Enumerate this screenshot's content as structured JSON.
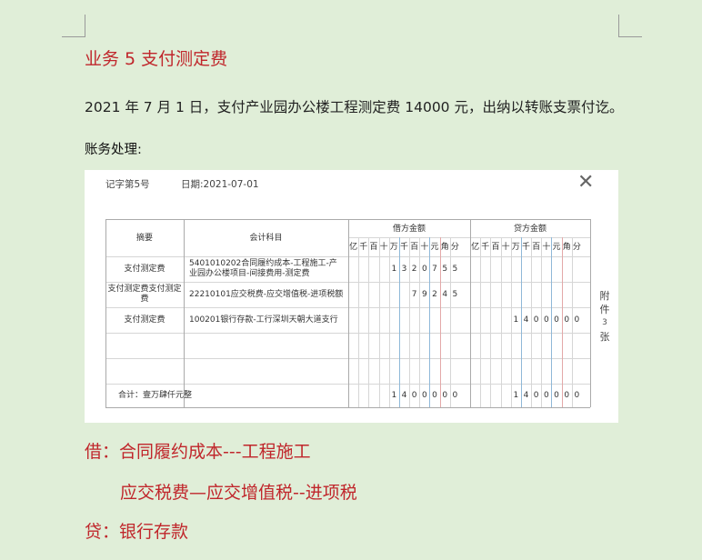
{
  "heading": "业务 5 支付测定费",
  "description": "2021 年 7 月 1 日，支付产业园办公楼工程测定费 14000 元，出纳以转账支票付讫。",
  "subheading": "账务处理:",
  "voucher": {
    "voucher_no": "记字第5号",
    "date": "日期:2021-07-01",
    "close_label": "✕",
    "headers": {
      "summary": "摘要",
      "account": "会计科目",
      "debit": "借方金额",
      "credit": "贷方金额",
      "units": [
        "亿",
        "千",
        "百",
        "十",
        "万",
        "千",
        "百",
        "十",
        "元",
        "角",
        "分"
      ]
    },
    "rows": [
      {
        "summary": "支付测定费",
        "account": "5401010202合同履约成本-工程施工-产业园办公楼项目-间接费用-测定费",
        "debit": [
          "",
          "",
          "",
          "",
          "1",
          "3",
          "2",
          "0",
          "7",
          "5",
          "5"
        ],
        "credit": [
          "",
          "",
          "",
          "",
          "",
          "",
          "",
          "",
          "",
          "",
          ""
        ]
      },
      {
        "summary": "支付测定费支付测定费",
        "account": "22210101应交税费-应交增值税-进项税额",
        "debit": [
          "",
          "",
          "",
          "",
          "",
          "",
          "7",
          "9",
          "2",
          "4",
          "5"
        ],
        "credit": [
          "",
          "",
          "",
          "",
          "",
          "",
          "",
          "",
          "",
          "",
          ""
        ]
      },
      {
        "summary": "支付测定费",
        "account": "100201银行存款-工行深圳天朝大道支行",
        "debit": [
          "",
          "",
          "",
          "",
          "",
          "",
          "",
          "",
          "",
          "",
          ""
        ],
        "credit": [
          "",
          "",
          "",
          "",
          "1",
          "4",
          "0",
          "0",
          "0",
          "0",
          "0"
        ]
      }
    ],
    "total": {
      "label": "合计：壹万肆仟元整",
      "debit": [
        "",
        "",
        "",
        "",
        "1",
        "4",
        "0",
        "0",
        "0",
        "0",
        "0"
      ],
      "credit": [
        "",
        "",
        "",
        "",
        "1",
        "4",
        "0",
        "0",
        "0",
        "0",
        "0"
      ]
    },
    "attachment": {
      "label1": "附",
      "label2": "件",
      "count": "3",
      "label3": "张"
    }
  },
  "entries": {
    "debit_1": "借：合同履约成本---工程施工",
    "debit_2": "应交税费—应交增值税--进项税",
    "credit_1": "贷：银行存款"
  }
}
